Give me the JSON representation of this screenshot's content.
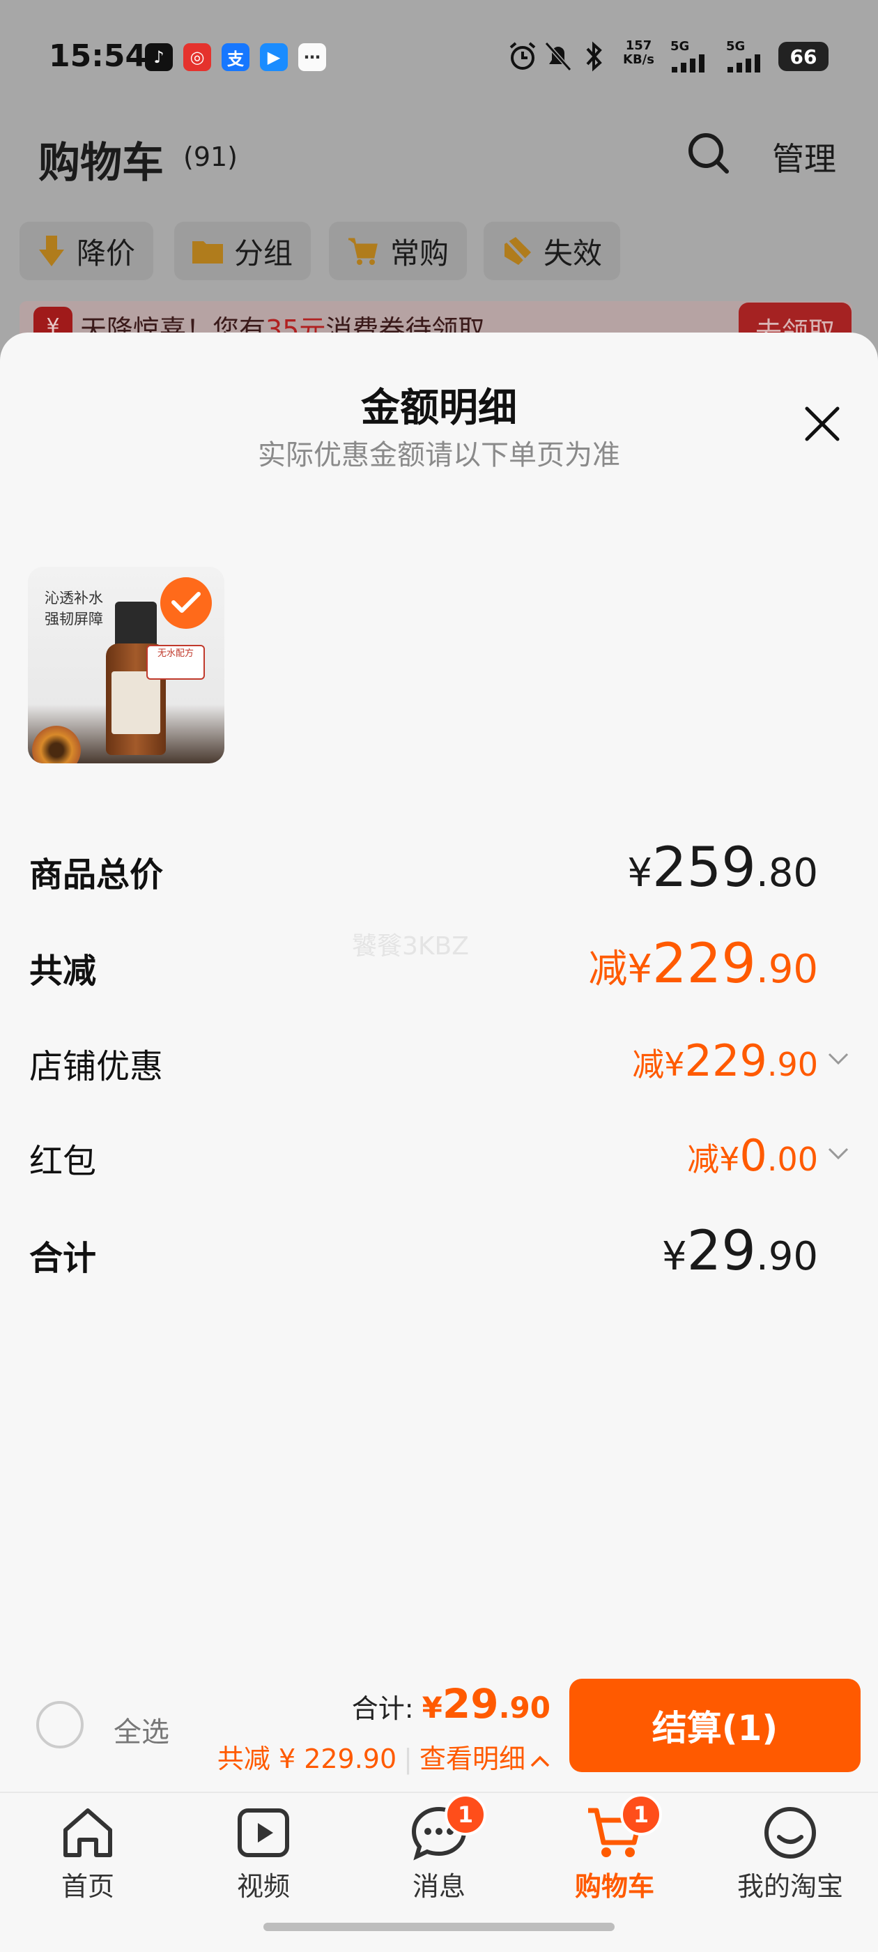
{
  "status_bar": {
    "time": "15:54",
    "net_speed_value": "157",
    "net_speed_unit": "KB/s",
    "signal_1": "5G",
    "signal_2": "5G",
    "battery": "66",
    "app_icons": [
      "tiktok-icon",
      "netease-music-icon",
      "alipay-icon",
      "video-player-icon",
      "message-app-icon"
    ]
  },
  "cart_page": {
    "title": "购物车",
    "count": "(91)",
    "manage_label": "管理",
    "filters": [
      {
        "label": "降价",
        "icon": "price-drop-icon"
      },
      {
        "label": "分组",
        "icon": "folder-icon"
      },
      {
        "label": "常购",
        "icon": "cart-plus-icon"
      },
      {
        "label": "失效",
        "icon": "expired-icon"
      }
    ],
    "banner": {
      "text_before": "天降惊喜！您有",
      "highlight": "35元",
      "text_after": "消费券待领取",
      "button_label": "去领取"
    }
  },
  "sheet": {
    "title": "金额明细",
    "subtitle": "实际优惠金额请以下单页为准",
    "product_image_text": [
      "沁透补水",
      "强韧屏障"
    ],
    "product_badge": "无水配方",
    "rows": [
      {
        "label": "商品总价",
        "prefix": "¥",
        "int": "259",
        "dec": ".80",
        "style": "black-big",
        "chevron": false
      },
      {
        "label": "共减",
        "prefix": "减¥",
        "int": "229",
        "dec": ".90",
        "style": "orange-big",
        "chevron": false
      },
      {
        "label": "店铺优惠",
        "prefix": "减¥",
        "int": "229",
        "dec": ".90",
        "style": "orange-small",
        "chevron": true
      },
      {
        "label": "红包",
        "prefix": "减¥",
        "int": "0",
        "dec": ".00",
        "style": "orange-small",
        "chevron": true
      },
      {
        "label": "合计",
        "prefix": "¥",
        "int": "29",
        "dec": ".90",
        "style": "black-big",
        "chevron": false
      }
    ],
    "watermark": "饕餮3KBZ"
  },
  "bottom_bar": {
    "select_all": "全选",
    "total_label": "合计: ",
    "total_prefix": "¥",
    "total_int": "29",
    "total_dec": ".90",
    "reduce_text": "共减 ¥ 229.90",
    "detail_link": "查看明细",
    "checkout_label": "结算(1)"
  },
  "tab_bar": [
    {
      "label": "首页",
      "icon": "home-icon",
      "badge": ""
    },
    {
      "label": "视频",
      "icon": "video-icon",
      "badge": ""
    },
    {
      "label": "消息",
      "icon": "message-icon",
      "badge": "1"
    },
    {
      "label": "购物车",
      "icon": "cart-icon",
      "badge": "1"
    },
    {
      "label": "我的淘宝",
      "icon": "smile-icon",
      "badge": ""
    }
  ],
  "colors": {
    "accent": "#ff5a00",
    "overlay_bg": "#a7a7a7",
    "sheet_bg": "#f7f7f7"
  }
}
